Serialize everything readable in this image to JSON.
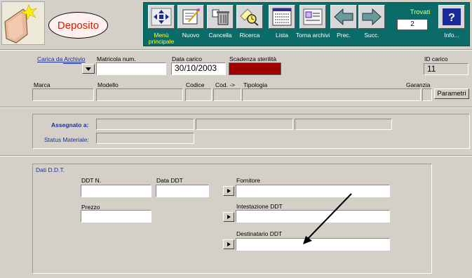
{
  "header": {
    "title": "Deposito"
  },
  "toolbar": {
    "buttons": [
      {
        "id": "menu",
        "label": "Menù principale",
        "icon": "move-arrows-icon"
      },
      {
        "id": "nuovo",
        "label": "Nuovo",
        "icon": "new-document-icon"
      },
      {
        "id": "cancella",
        "label": "Cancella",
        "icon": "trash-icon"
      },
      {
        "id": "ricerca",
        "label": "Ricerca",
        "icon": "search-icon"
      },
      {
        "id": "lista",
        "label": "Lista",
        "icon": "list-icon"
      },
      {
        "id": "torna",
        "label": "Torna archivi",
        "icon": "archive-icon"
      },
      {
        "id": "prec",
        "label": "Prec.",
        "icon": "arrow-left-icon"
      },
      {
        "id": "succ",
        "label": "Succ.",
        "icon": "arrow-right-icon"
      },
      {
        "id": "info",
        "label": "Info...",
        "icon": "question-icon"
      }
    ],
    "trovati_label": "Trovati",
    "trovati_value": "2"
  },
  "form": {
    "carica_label": "Carica da Archivio",
    "matricola_label": "Matricola num.",
    "matricola_value": "",
    "data_carico_label": "Data carico",
    "data_carico_value": "30/10/2003",
    "scadenza_label": "Scadenza sterilità",
    "id_carico_label": "ID carico",
    "id_carico_value": "11",
    "marca_label": "Marca",
    "modello_label": "Modello",
    "codice_label": "Codice",
    "cod_label": "Cod. ->",
    "tipologia_label": "Tipologia",
    "garanzia_label": "Garanzia",
    "parametri_label": "Parametri",
    "assegnato_label": "Assegnato a:",
    "status_label": "Status Materiale:"
  },
  "ddt": {
    "section_label": "Dati D.D.T.",
    "ddt_n_label": "DDT N.",
    "data_ddt_label": "Data DDT",
    "fornitore_label": "Fornitore",
    "prezzo_label": "Prezzo",
    "intestazione_label": "Intestazione DDT",
    "destinatario_label": "Destinatario DDT"
  },
  "colors": {
    "toolbar_bg": "#0b6b68",
    "scadenza_fill": "#a00000",
    "title_text": "#cc2200",
    "label_blue": "#1c2f9a"
  }
}
